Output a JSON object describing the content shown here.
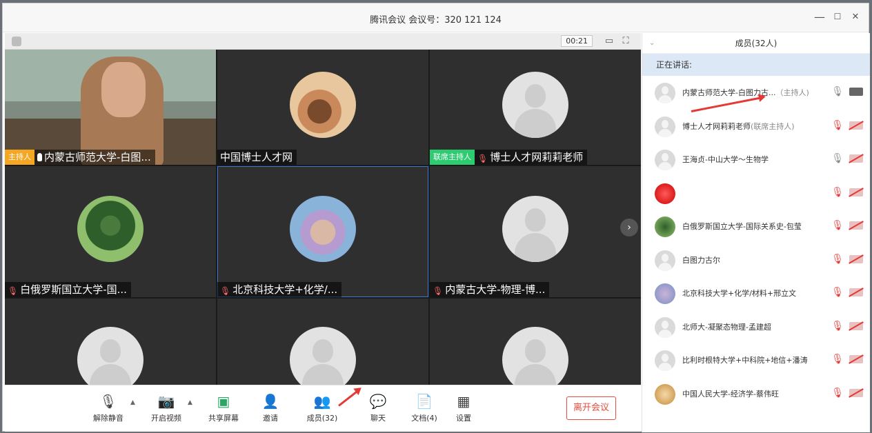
{
  "window": {
    "title": "腾讯会议 会议号：320 121 124",
    "controls": {
      "minimize": "—",
      "maximize": "☐",
      "close": "✕"
    }
  },
  "video_topbar": {
    "timer": "00:21"
  },
  "tiles": [
    {
      "name": "内蒙古师范大学-白图...",
      "tag": "主持人",
      "tag_type": "host",
      "mic": "on",
      "kind": "video"
    },
    {
      "name": "中国博士人才网",
      "tag": "",
      "mic": "none",
      "kind": "photo1"
    },
    {
      "name": "博士人才网莉莉老师",
      "tag": "联席主持人",
      "tag_type": "cohost",
      "mic": "off",
      "kind": "default"
    },
    {
      "name": "白俄罗斯国立大学-国...",
      "tag": "",
      "mic": "off",
      "kind": "photo2"
    },
    {
      "name": "北京科技大学+化学/...",
      "tag": "",
      "mic": "off",
      "kind": "photo3"
    },
    {
      "name": "内蒙古大学-物理-博...",
      "tag": "",
      "mic": "off",
      "kind": "default"
    },
    {
      "name": "",
      "tag": "",
      "mic": "none",
      "kind": "default"
    },
    {
      "name": "",
      "tag": "",
      "mic": "none",
      "kind": "default"
    },
    {
      "name": "",
      "tag": "",
      "mic": "none",
      "kind": "default"
    }
  ],
  "toolbar": {
    "unmute": "解除静音",
    "start_video": "开启视频",
    "share_screen": "共享屏幕",
    "invite": "邀请",
    "members": "成员(32)",
    "chat": "聊天",
    "docs": "文档(4)",
    "settings": "设置",
    "leave": "离开会议"
  },
  "panel": {
    "title": "成员(32人)",
    "speaking": "正在讲话:",
    "members": [
      {
        "name": "内蒙古师范大学-白图力古...",
        "role": "（主持人)",
        "mic": "on",
        "cam": "on",
        "avatar": "default"
      },
      {
        "name": "博士人才网莉莉老师",
        "role": "(联席主持人)",
        "mic": "off",
        "cam": "off",
        "avatar": "default"
      },
      {
        "name": "王海贞-中山大学～生物学",
        "role": "",
        "mic": "on",
        "cam": "off",
        "avatar": "default"
      },
      {
        "name": "",
        "role": "",
        "mic": "off",
        "cam": "off",
        "avatar": "red"
      },
      {
        "name": "白俄罗斯国立大学-国际关系史-包莹",
        "role": "",
        "mic": "off",
        "cam": "off",
        "avatar": "green"
      },
      {
        "name": "白图力古尔",
        "role": "",
        "mic": "off",
        "cam": "off",
        "avatar": "default"
      },
      {
        "name": "北京科技大学+化学/材料+邢立文",
        "role": "",
        "mic": "off",
        "cam": "off",
        "avatar": "purple"
      },
      {
        "name": "北师大-凝聚态物理-孟建超",
        "role": "",
        "mic": "off",
        "cam": "off",
        "avatar": "default"
      },
      {
        "name": "比利时根特大学+中科院+地信+潘涛",
        "role": "",
        "mic": "off",
        "cam": "off",
        "avatar": "default"
      },
      {
        "name": "中国人民大学-经济学-蔡伟旺",
        "role": "",
        "mic": "off",
        "cam": "off",
        "avatar": "gold"
      }
    ]
  },
  "colors": {
    "accent": "#3a7bd5",
    "danger": "#e53935",
    "host_tag": "#f5a623",
    "cohost_tag": "#2ecc71"
  }
}
